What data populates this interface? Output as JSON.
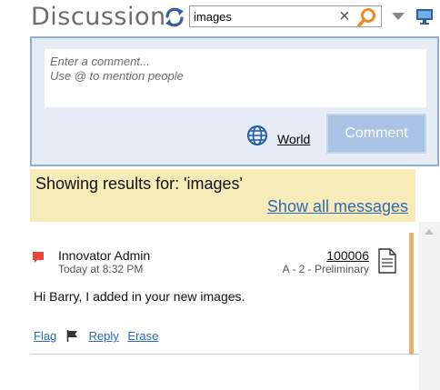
{
  "header": {
    "title": "Discussion",
    "search": {
      "value": "images",
      "clear_label": "×"
    }
  },
  "composer": {
    "placeholder_line1": "Enter a comment...",
    "placeholder_line2": "Use @ to mention people",
    "visibility_label": "World",
    "submit_label": "Comment"
  },
  "results": {
    "showing_text": "Showing results for: 'images'",
    "show_all_label": "Show all messages"
  },
  "messages": [
    {
      "author": "Innovator Admin",
      "time": "Today at 8:32 PM",
      "item_number": "100006",
      "item_desc": "A - 2 - Preliminary",
      "body": "Hi Barry, I added in your new images.",
      "actions": {
        "flag": "Flag",
        "reply": "Reply",
        "erase": "Erase"
      }
    }
  ],
  "colors": {
    "title": "#6d6d6d",
    "search_icon": "#f08a24",
    "panel_bg": "#e6edf7",
    "panel_border": "#8daed8",
    "comment_button": "#a9c2e6",
    "banner_bg": "#f7ecb8",
    "link": "#2a6ab8",
    "message_accent": "#e0b574",
    "speech_icon": "#e8453c"
  },
  "icons": {
    "refresh": "refresh-icon",
    "search": "search-icon",
    "dropdown": "chevron-down-icon",
    "layout": "monitor-icon",
    "visibility": "globe-icon",
    "message": "speech-bubble-icon",
    "document": "document-icon",
    "flag": "flag-icon"
  }
}
